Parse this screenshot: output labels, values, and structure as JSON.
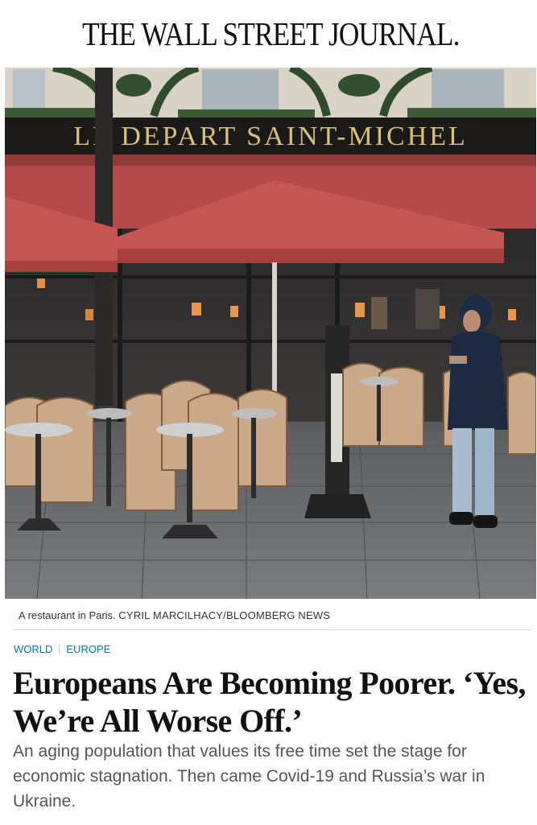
{
  "masthead": {
    "title": "THE WALL STREET JOURNAL."
  },
  "photo": {
    "sign_text": "LE DEPART SAINT-MICHEL",
    "caption": "A restaurant in Paris.",
    "credit": "CYRIL MARCILHACY/BLOOMBERG NEWS"
  },
  "breadcrumbs": [
    "WORLD",
    "EUROPE"
  ],
  "article": {
    "headline": "Europeans Are Becoming Poorer. ‘Yes, We’re All Worse Off.’",
    "dek": "An aging population that values its free time set the stage for economic stagnation. Then came Covid-19 and Russia’s war in Ukraine."
  },
  "colors": {
    "link": "#0274b6",
    "umbrella": "#c65655",
    "sign_gold": "#d9bf7c"
  }
}
